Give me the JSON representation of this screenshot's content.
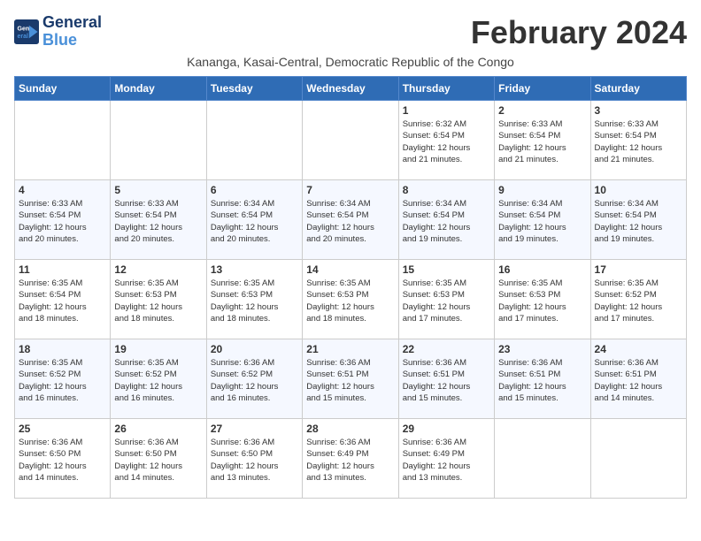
{
  "logo": {
    "line1": "General",
    "line2": "Blue"
  },
  "title": "February 2024",
  "location": "Kananga, Kasai-Central, Democratic Republic of the Congo",
  "header_days": [
    "Sunday",
    "Monday",
    "Tuesday",
    "Wednesday",
    "Thursday",
    "Friday",
    "Saturday"
  ],
  "weeks": [
    [
      {
        "day": "",
        "info": ""
      },
      {
        "day": "",
        "info": ""
      },
      {
        "day": "",
        "info": ""
      },
      {
        "day": "",
        "info": ""
      },
      {
        "day": "1",
        "info": "Sunrise: 6:32 AM\nSunset: 6:54 PM\nDaylight: 12 hours\nand 21 minutes."
      },
      {
        "day": "2",
        "info": "Sunrise: 6:33 AM\nSunset: 6:54 PM\nDaylight: 12 hours\nand 21 minutes."
      },
      {
        "day": "3",
        "info": "Sunrise: 6:33 AM\nSunset: 6:54 PM\nDaylight: 12 hours\nand 21 minutes."
      }
    ],
    [
      {
        "day": "4",
        "info": "Sunrise: 6:33 AM\nSunset: 6:54 PM\nDaylight: 12 hours\nand 20 minutes."
      },
      {
        "day": "5",
        "info": "Sunrise: 6:33 AM\nSunset: 6:54 PM\nDaylight: 12 hours\nand 20 minutes."
      },
      {
        "day": "6",
        "info": "Sunrise: 6:34 AM\nSunset: 6:54 PM\nDaylight: 12 hours\nand 20 minutes."
      },
      {
        "day": "7",
        "info": "Sunrise: 6:34 AM\nSunset: 6:54 PM\nDaylight: 12 hours\nand 20 minutes."
      },
      {
        "day": "8",
        "info": "Sunrise: 6:34 AM\nSunset: 6:54 PM\nDaylight: 12 hours\nand 19 minutes."
      },
      {
        "day": "9",
        "info": "Sunrise: 6:34 AM\nSunset: 6:54 PM\nDaylight: 12 hours\nand 19 minutes."
      },
      {
        "day": "10",
        "info": "Sunrise: 6:34 AM\nSunset: 6:54 PM\nDaylight: 12 hours\nand 19 minutes."
      }
    ],
    [
      {
        "day": "11",
        "info": "Sunrise: 6:35 AM\nSunset: 6:54 PM\nDaylight: 12 hours\nand 18 minutes."
      },
      {
        "day": "12",
        "info": "Sunrise: 6:35 AM\nSunset: 6:53 PM\nDaylight: 12 hours\nand 18 minutes."
      },
      {
        "day": "13",
        "info": "Sunrise: 6:35 AM\nSunset: 6:53 PM\nDaylight: 12 hours\nand 18 minutes."
      },
      {
        "day": "14",
        "info": "Sunrise: 6:35 AM\nSunset: 6:53 PM\nDaylight: 12 hours\nand 18 minutes."
      },
      {
        "day": "15",
        "info": "Sunrise: 6:35 AM\nSunset: 6:53 PM\nDaylight: 12 hours\nand 17 minutes."
      },
      {
        "day": "16",
        "info": "Sunrise: 6:35 AM\nSunset: 6:53 PM\nDaylight: 12 hours\nand 17 minutes."
      },
      {
        "day": "17",
        "info": "Sunrise: 6:35 AM\nSunset: 6:52 PM\nDaylight: 12 hours\nand 17 minutes."
      }
    ],
    [
      {
        "day": "18",
        "info": "Sunrise: 6:35 AM\nSunset: 6:52 PM\nDaylight: 12 hours\nand 16 minutes."
      },
      {
        "day": "19",
        "info": "Sunrise: 6:35 AM\nSunset: 6:52 PM\nDaylight: 12 hours\nand 16 minutes."
      },
      {
        "day": "20",
        "info": "Sunrise: 6:36 AM\nSunset: 6:52 PM\nDaylight: 12 hours\nand 16 minutes."
      },
      {
        "day": "21",
        "info": "Sunrise: 6:36 AM\nSunset: 6:51 PM\nDaylight: 12 hours\nand 15 minutes."
      },
      {
        "day": "22",
        "info": "Sunrise: 6:36 AM\nSunset: 6:51 PM\nDaylight: 12 hours\nand 15 minutes."
      },
      {
        "day": "23",
        "info": "Sunrise: 6:36 AM\nSunset: 6:51 PM\nDaylight: 12 hours\nand 15 minutes."
      },
      {
        "day": "24",
        "info": "Sunrise: 6:36 AM\nSunset: 6:51 PM\nDaylight: 12 hours\nand 14 minutes."
      }
    ],
    [
      {
        "day": "25",
        "info": "Sunrise: 6:36 AM\nSunset: 6:50 PM\nDaylight: 12 hours\nand 14 minutes."
      },
      {
        "day": "26",
        "info": "Sunrise: 6:36 AM\nSunset: 6:50 PM\nDaylight: 12 hours\nand 14 minutes."
      },
      {
        "day": "27",
        "info": "Sunrise: 6:36 AM\nSunset: 6:50 PM\nDaylight: 12 hours\nand 13 minutes."
      },
      {
        "day": "28",
        "info": "Sunrise: 6:36 AM\nSunset: 6:49 PM\nDaylight: 12 hours\nand 13 minutes."
      },
      {
        "day": "29",
        "info": "Sunrise: 6:36 AM\nSunset: 6:49 PM\nDaylight: 12 hours\nand 13 minutes."
      },
      {
        "day": "",
        "info": ""
      },
      {
        "day": "",
        "info": ""
      }
    ]
  ]
}
